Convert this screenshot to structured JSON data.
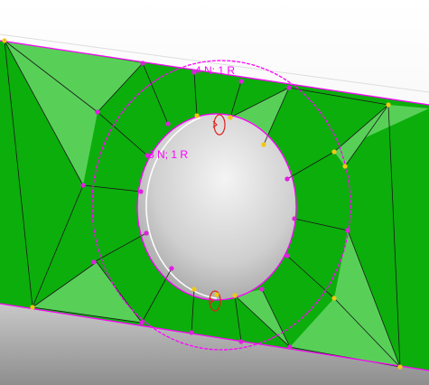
{
  "viewport": {
    "background_top": "#ffffff",
    "background_bottom": "#a8a8a8",
    "plate_color_dark": "#0cae0c",
    "plate_color_light": "#58d058",
    "boundary_color": "#ff00ff",
    "node_color": "#ffd400"
  },
  "annotations": {
    "outer_ring_label": "4 N; 1 R",
    "inner_ring_label": "8 N; 1 R"
  }
}
